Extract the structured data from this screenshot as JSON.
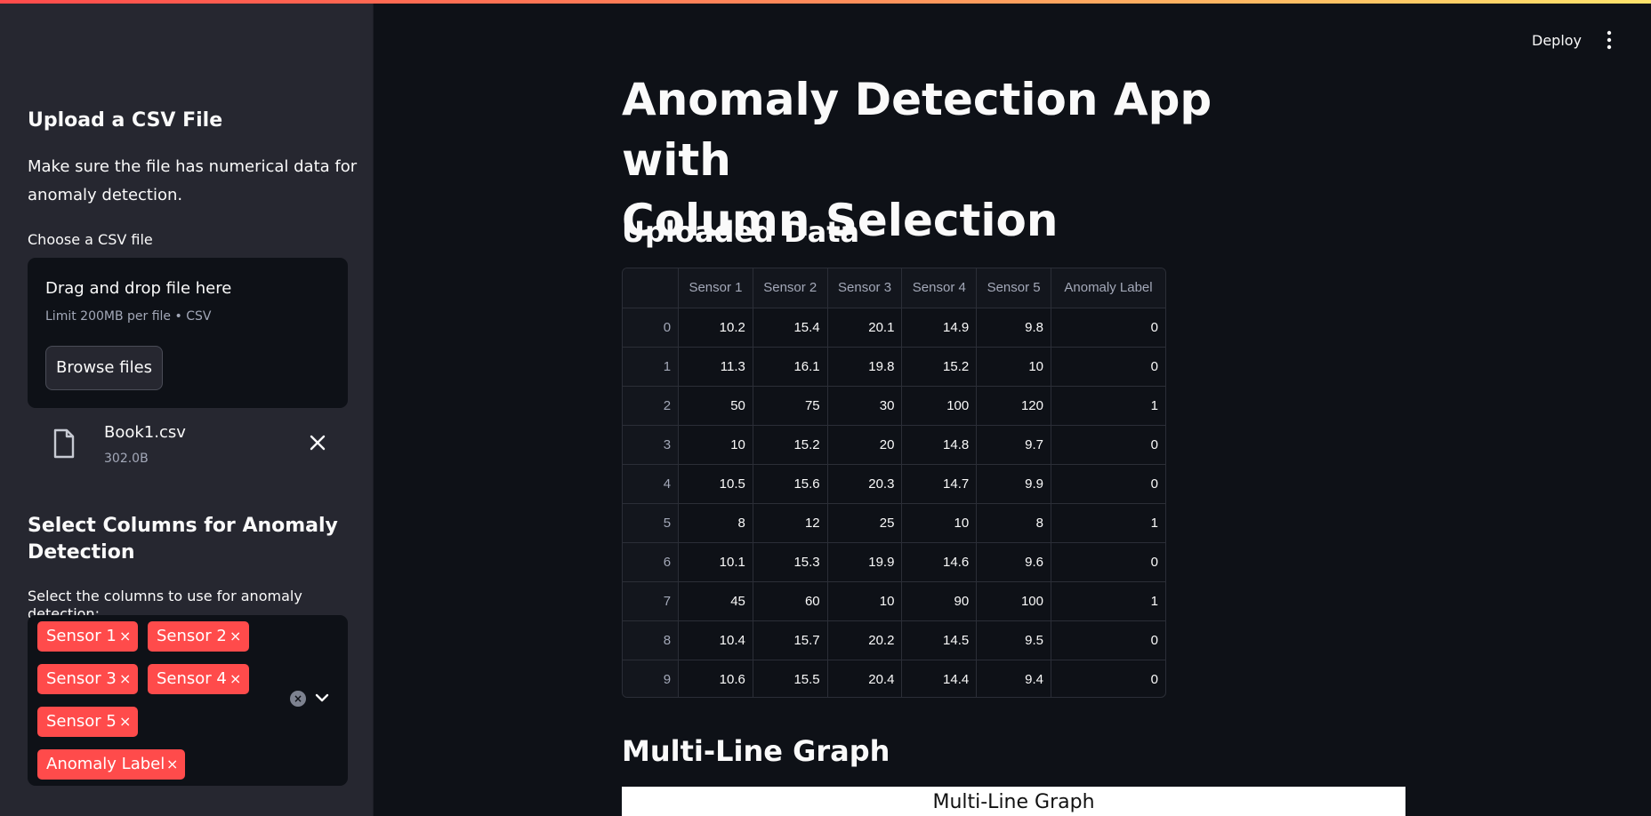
{
  "header": {
    "deploy_label": "Deploy",
    "menu_icon": "kebab-menu-icon"
  },
  "sidebar": {
    "upload_heading": "Upload a CSV File",
    "upload_desc_line1": "Make sure the file has numerical data for",
    "upload_desc_line2": "anomaly detection.",
    "uploader_label": "Choose a CSV file",
    "dropzone_title": "Drag and drop file here",
    "dropzone_limit": "Limit 200MB per file • CSV",
    "browse_label": "Browse files",
    "file": {
      "name": "Book1.csv",
      "size": "302.0B",
      "icon": "file-icon"
    },
    "select_heading_line1": "Select Columns for Anomaly",
    "select_heading_line2": "Detection",
    "select_label": "Select the columns to use for anomaly detection:",
    "selected_tags": [
      "Sensor 1",
      "Sensor 2",
      "Sensor 3",
      "Sensor 4",
      "Sensor 5",
      "Anomaly Label"
    ],
    "tag_remove_glyph": "×"
  },
  "main": {
    "title_line1": "Anomaly Detection App with",
    "title_line2": "Column Selection",
    "uploaded_heading": "Uploaded Data",
    "graph_heading": "Multi-Line Graph",
    "chart_title": "Multi-Line Graph"
  },
  "table": {
    "columns": [
      "",
      "Sensor 1",
      "Sensor 2",
      "Sensor 3",
      "Sensor 4",
      "Sensor 5",
      "Anomaly Label"
    ],
    "rows": [
      [
        "0",
        "10.2",
        "15.4",
        "20.1",
        "14.9",
        "9.8",
        "0"
      ],
      [
        "1",
        "11.3",
        "16.1",
        "19.8",
        "15.2",
        "10",
        "0"
      ],
      [
        "2",
        "50",
        "75",
        "30",
        "100",
        "120",
        "1"
      ],
      [
        "3",
        "10",
        "15.2",
        "20",
        "14.8",
        "9.7",
        "0"
      ],
      [
        "4",
        "10.5",
        "15.6",
        "20.3",
        "14.7",
        "9.9",
        "0"
      ],
      [
        "5",
        "8",
        "12",
        "25",
        "10",
        "8",
        "1"
      ],
      [
        "6",
        "10.1",
        "15.3",
        "19.9",
        "14.6",
        "9.6",
        "0"
      ],
      [
        "7",
        "45",
        "60",
        "10",
        "90",
        "100",
        "1"
      ],
      [
        "8",
        "10.4",
        "15.7",
        "20.2",
        "14.5",
        "9.5",
        "0"
      ],
      [
        "9",
        "10.6",
        "15.5",
        "20.4",
        "14.4",
        "9.4",
        "0"
      ]
    ]
  },
  "colors": {
    "accent": "#ff4b4b",
    "background": "#0e1117",
    "sidebar": "#262730"
  }
}
